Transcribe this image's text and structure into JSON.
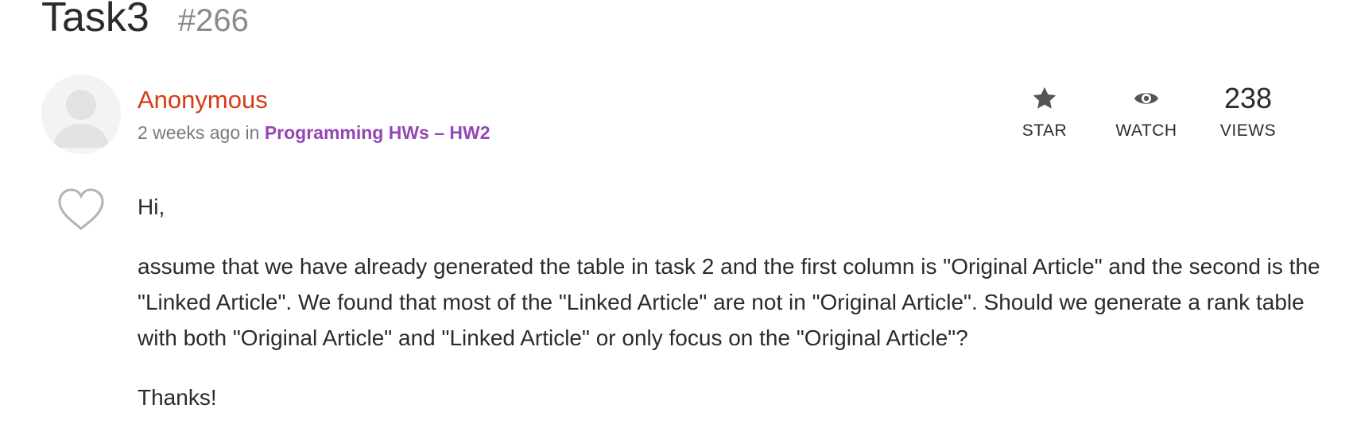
{
  "thread": {
    "title": "Task3",
    "number": "#266"
  },
  "post": {
    "author": "Anonymous",
    "time_ago": "2 weeks ago",
    "in_word": "in",
    "category": "Programming HWs – HW2",
    "body": {
      "greeting": "Hi,",
      "paragraph": "assume that we have already generated the table in task 2 and the first column is \"Original Article\" and the second is the \"Linked Article\". We found that most of the \"Linked Article\" are not in \"Original Article\". Should we generate a rank table with both \"Original Article\" and \"Linked Article\" or only focus on the \"Original Article\"?",
      "closing": "Thanks!"
    }
  },
  "stats": {
    "star_label": "STAR",
    "watch_label": "WATCH",
    "views_count": "238",
    "views_label": "VIEWS"
  },
  "colors": {
    "author": "#d83a13",
    "category": "#9347b5",
    "icon": "#555555",
    "text": "#2b2b2b"
  },
  "icons": {
    "star": "star-icon",
    "watch": "eye-icon",
    "like": "heart-outline-icon",
    "avatar": "default-user-avatar"
  }
}
